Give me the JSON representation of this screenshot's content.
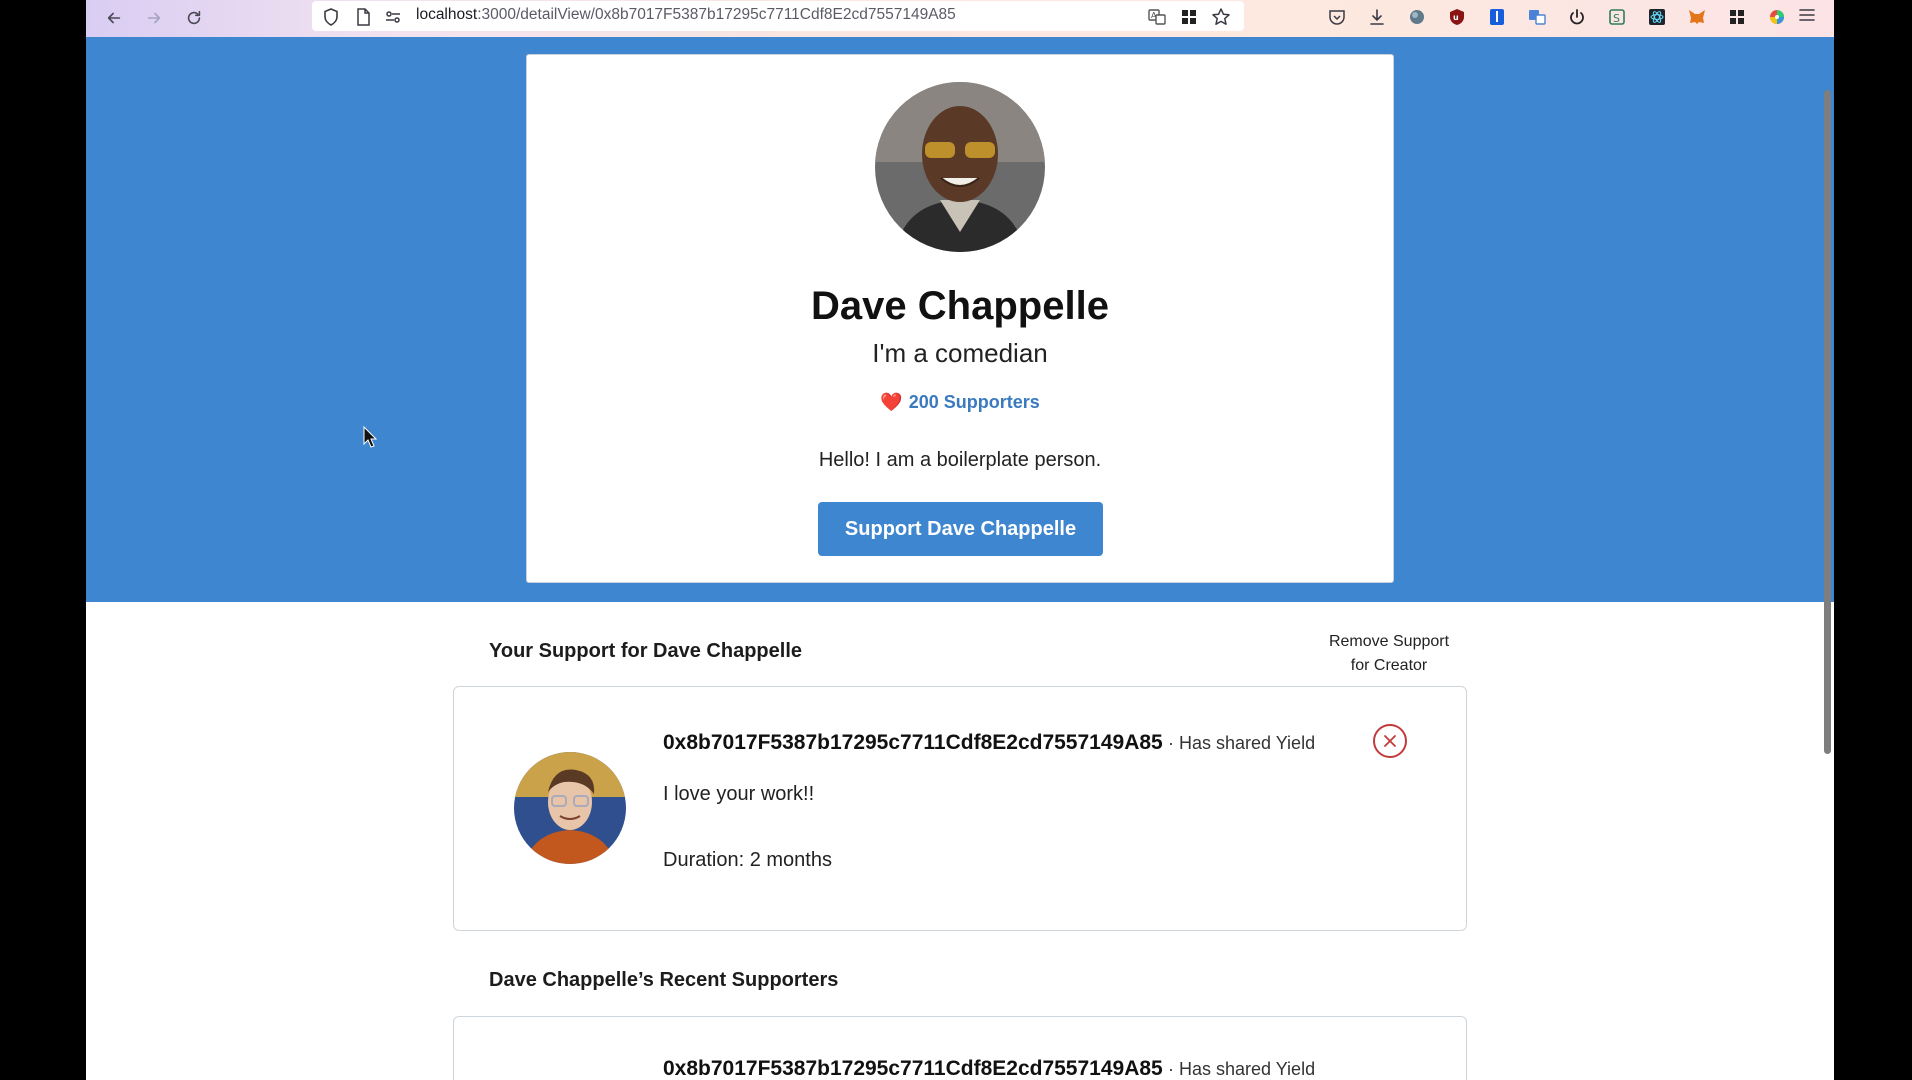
{
  "browser": {
    "url_host": "localhost",
    "url_path": ":3000/detailView/0x8b7017F5387b17295c7711Cdf8E2cd7557149A85"
  },
  "creator": {
    "name": "Dave Chappelle",
    "tagline": "I'm a comedian",
    "supporters_heart": "❤️",
    "supporters_label": "200 Supporters",
    "bio": "Hello! I am a boilerplate person.",
    "support_button": "Support Dave Chappelle"
  },
  "your_support": {
    "title": "Your Support for Dave Chappelle",
    "remove_line1": "Remove Support",
    "remove_line2": "for Creator",
    "card": {
      "address": "0x8b7017F5387b17295c7711Cdf8E2cd7557149A85",
      "shared": "· Has shared Yield",
      "message": "I love your work!!",
      "duration": "Duration: 2 months"
    }
  },
  "recent": {
    "title": "Dave Chappelle’s Recent Supporters",
    "card": {
      "address": "0x8b7017F5387b17295c7711Cdf8E2cd7557149A85",
      "shared": "· Has shared Yield"
    }
  },
  "colors": {
    "hero": "#3f86d0",
    "accent_text": "#3a7abf",
    "remove_red": "#c23b3b"
  },
  "icons": [
    "back-arrow-icon",
    "forward-arrow-icon",
    "reload-icon",
    "shield-icon",
    "page-icon",
    "permissions-icon",
    "translate-icon",
    "grid-icon",
    "star-icon",
    "pocket-icon",
    "download-icon",
    "extension-icon",
    "ublock-icon",
    "bitwarden-icon",
    "power-icon",
    "metamask-icon",
    "menu-icon",
    "heart-icon",
    "close-icon",
    "cursor-icon"
  ]
}
